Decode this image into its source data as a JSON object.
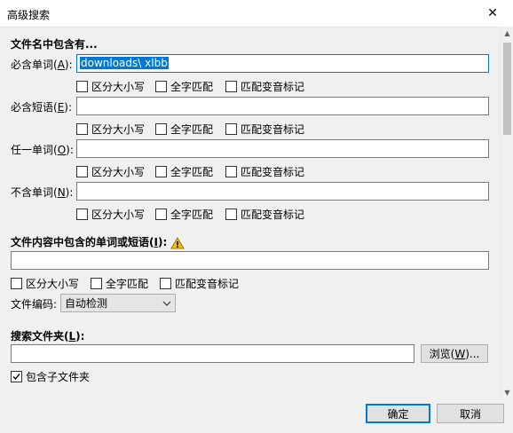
{
  "window": {
    "title": "高级搜索",
    "close_glyph": "✕"
  },
  "filename_section": {
    "heading": "文件名中包含有...",
    "rows": [
      {
        "label_pre": "必含单词(",
        "accel": "A",
        "label_post": "):",
        "value": "downloads\\ xlbb",
        "focused": true
      },
      {
        "label_pre": "必含短语(",
        "accel": "E",
        "label_post": "):",
        "value": "",
        "focused": false
      },
      {
        "label_pre": "任一单词(",
        "accel": "O",
        "label_post": "):",
        "value": "",
        "focused": false
      },
      {
        "label_pre": "不含单词(",
        "accel": "N",
        "label_post": "):",
        "value": "",
        "focused": false
      }
    ],
    "options": {
      "case": "区分大小写",
      "whole": "全字匹配",
      "accent": "匹配变音标记"
    }
  },
  "content_section": {
    "heading_pre": "文件内容中包含的单词或短语(",
    "heading_accel": "I",
    "heading_post": "):",
    "value": "",
    "options": {
      "case": "区分大小写",
      "whole": "全字匹配",
      "accent": "匹配变音标记"
    },
    "encoding_label": "文件编码:",
    "encoding_value": "自动检测"
  },
  "folder_section": {
    "heading_pre": "搜索文件夹(",
    "heading_accel": "L",
    "heading_post": "):",
    "value": "",
    "browse_pre": "浏览(",
    "browse_accel": "W",
    "browse_post": ")...",
    "include_subfolders": "包含子文件夹",
    "include_subfolders_checked": true
  },
  "footer": {
    "ok": "确定",
    "cancel": "取消"
  },
  "colors": {
    "accent": "#0078d7",
    "warning": "#f5c000"
  }
}
